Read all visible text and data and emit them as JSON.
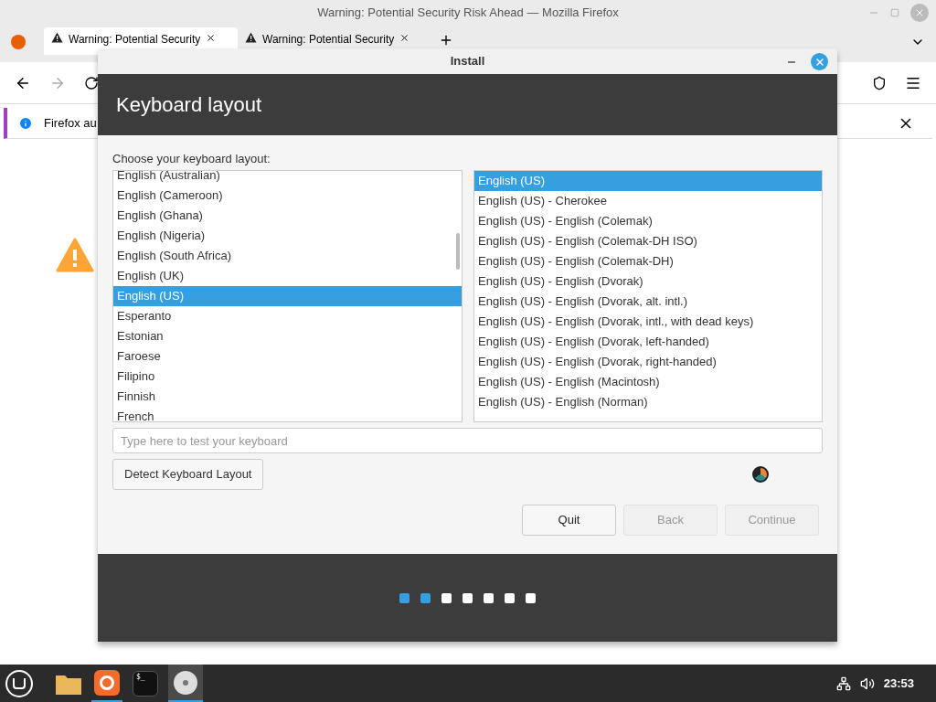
{
  "browser": {
    "title": "Warning: Potential Security Risk Ahead — Mozilla Firefox",
    "tabs": [
      {
        "label": "Warning: Potential Security",
        "selected": true
      },
      {
        "label": "Warning: Potential Security",
        "selected": false
      }
    ],
    "notification": "Firefox au"
  },
  "dialog": {
    "title": "Install",
    "heading": "Keyboard layout",
    "prompt": "Choose your keyboard layout:",
    "layouts": [
      {
        "label": "English (Australian)",
        "selected": false
      },
      {
        "label": "English (Cameroon)",
        "selected": false
      },
      {
        "label": "English (Ghana)",
        "selected": false
      },
      {
        "label": "English (Nigeria)",
        "selected": false
      },
      {
        "label": "English (South Africa)",
        "selected": false
      },
      {
        "label": "English (UK)",
        "selected": false
      },
      {
        "label": "English (US)",
        "selected": true
      },
      {
        "label": "Esperanto",
        "selected": false
      },
      {
        "label": "Estonian",
        "selected": false
      },
      {
        "label": "Faroese",
        "selected": false
      },
      {
        "label": "Filipino",
        "selected": false
      },
      {
        "label": "Finnish",
        "selected": false
      },
      {
        "label": "French",
        "selected": false
      }
    ],
    "variants": [
      {
        "label": "English (US)",
        "selected": true
      },
      {
        "label": "English (US) - Cherokee",
        "selected": false
      },
      {
        "label": "English (US) - English (Colemak)",
        "selected": false
      },
      {
        "label": "English (US) - English (Colemak-DH ISO)",
        "selected": false
      },
      {
        "label": "English (US) - English (Colemak-DH)",
        "selected": false
      },
      {
        "label": "English (US) - English (Dvorak)",
        "selected": false
      },
      {
        "label": "English (US) - English (Dvorak, alt. intl.)",
        "selected": false
      },
      {
        "label": "English (US) - English (Dvorak, intl., with dead keys)",
        "selected": false
      },
      {
        "label": "English (US) - English (Dvorak, left-handed)",
        "selected": false
      },
      {
        "label": "English (US) - English (Dvorak, right-handed)",
        "selected": false
      },
      {
        "label": "English (US) - English (Macintosh)",
        "selected": false
      },
      {
        "label": "English (US) - English (Norman)",
        "selected": false
      }
    ],
    "test_field": {
      "placeholder": "Type here to test your keyboard"
    },
    "detect_button": "Detect Keyboard Layout",
    "buttons": [
      {
        "label": "Quit",
        "disabled": false
      },
      {
        "label": "Back",
        "disabled": true
      },
      {
        "label": "Continue",
        "disabled": true
      }
    ],
    "steps": [
      {
        "done": true
      },
      {
        "done": true
      },
      {
        "done": false
      },
      {
        "done": false
      },
      {
        "done": false
      },
      {
        "done": false
      },
      {
        "done": false
      }
    ]
  },
  "taskbar": {
    "terminal_glyph": "$_",
    "clock": "23:53"
  }
}
